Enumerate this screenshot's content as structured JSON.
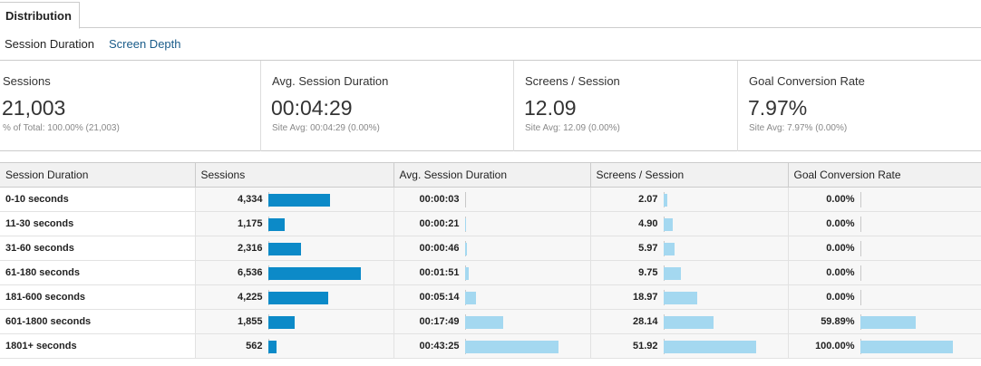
{
  "tabs": {
    "distribution": "Distribution"
  },
  "subnav": {
    "active": "Session Duration",
    "link": "Screen Depth"
  },
  "scorecards": [
    {
      "title": "Sessions",
      "value": "21,003",
      "sub": "% of Total: 100.00% (21,003)"
    },
    {
      "title": "Avg. Session Duration",
      "value": "00:04:29",
      "sub": "Site Avg: 00:04:29 (0.00%)"
    },
    {
      "title": "Screens / Session",
      "value": "12.09",
      "sub": "Site Avg: 12.09 (0.00%)"
    },
    {
      "title": "Goal Conversion Rate",
      "value": "7.97%",
      "sub": "Site Avg: 7.97% (0.00%)"
    }
  ],
  "table": {
    "headers": [
      "Session Duration",
      "Sessions",
      "Avg. Session Duration",
      "Screens / Session",
      "Goal Conversion Rate"
    ],
    "colors": {
      "sessions_bar": "#0c8ac8",
      "metric_bar": "#a4d8f0"
    },
    "rows": [
      {
        "label": "0-10 seconds",
        "sessions": "4,334",
        "sessions_frac": 0.6631,
        "avg": "00:00:03",
        "avg_frac": 0.0012,
        "screens": "2.07",
        "screens_frac": 0.0399,
        "goal": "0.00%",
        "goal_frac": 0.0
      },
      {
        "label": "11-30 seconds",
        "sessions": "1,175",
        "sessions_frac": 0.1798,
        "avg": "00:00:21",
        "avg_frac": 0.0081,
        "screens": "4.90",
        "screens_frac": 0.0944,
        "goal": "0.00%",
        "goal_frac": 0.0
      },
      {
        "label": "31-60 seconds",
        "sessions": "2,316",
        "sessions_frac": 0.3543,
        "avg": "00:00:46",
        "avg_frac": 0.0177,
        "screens": "5.97",
        "screens_frac": 0.115,
        "goal": "0.00%",
        "goal_frac": 0.0
      },
      {
        "label": "61-180 seconds",
        "sessions": "6,536",
        "sessions_frac": 1.0,
        "avg": "00:01:51",
        "avg_frac": 0.0427,
        "screens": "9.75",
        "screens_frac": 0.1878,
        "goal": "0.00%",
        "goal_frac": 0.0
      },
      {
        "label": "181-600 seconds",
        "sessions": "4,225",
        "sessions_frac": 0.6464,
        "avg": "00:05:14",
        "avg_frac": 0.1208,
        "screens": "18.97",
        "screens_frac": 0.3654,
        "goal": "0.00%",
        "goal_frac": 0.0
      },
      {
        "label": "601-1800 seconds",
        "sessions": "1,855",
        "sessions_frac": 0.2838,
        "avg": "00:17:49",
        "avg_frac": 0.4115,
        "screens": "28.14",
        "screens_frac": 0.542,
        "goal": "59.89%",
        "goal_frac": 0.5989
      },
      {
        "label": "1801+ seconds",
        "sessions": "562",
        "sessions_frac": 0.086,
        "avg": "00:43:25",
        "avg_frac": 1.0,
        "screens": "51.92",
        "screens_frac": 1.0,
        "goal": "100.00%",
        "goal_frac": 1.0
      }
    ]
  }
}
